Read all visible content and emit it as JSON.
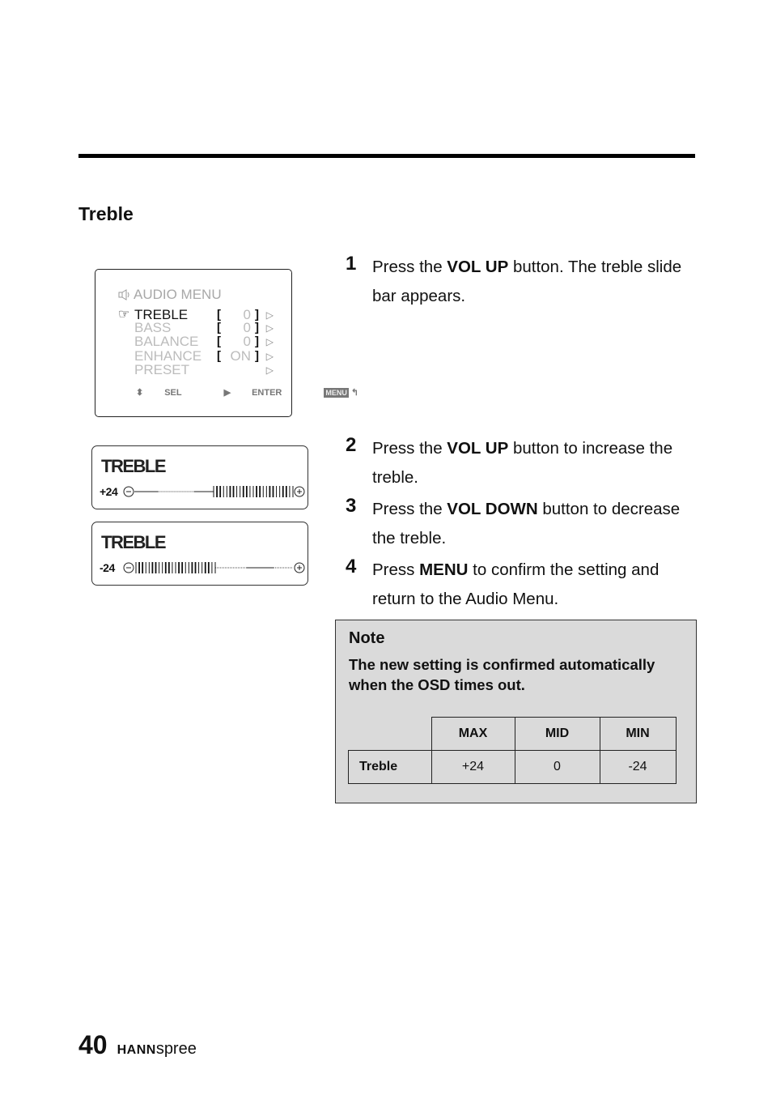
{
  "section_title": "Treble",
  "osd_menu": {
    "title": "AUDIO  MENU",
    "items": [
      {
        "label": "TREBLE",
        "value": "0",
        "selected": true,
        "has_brackets": true
      },
      {
        "label": "BASS",
        "value": "0",
        "selected": false,
        "has_brackets": true
      },
      {
        "label": "BALANCE",
        "value": "0",
        "selected": false,
        "has_brackets": true
      },
      {
        "label": "ENHANCE",
        "value": "ON",
        "selected": false,
        "has_brackets": true
      },
      {
        "label": "PRESET",
        "value": "",
        "selected": false,
        "has_brackets": false
      }
    ],
    "footer": {
      "sel": "SEL",
      "enter": "ENTER",
      "menu": "MENU"
    }
  },
  "sliders": [
    {
      "title": "TREBLE",
      "value_label": "+24",
      "fill_fraction": 1.0
    },
    {
      "title": "TREBLE",
      "value_label": "-24",
      "fill_fraction": 0.0
    }
  ],
  "steps": [
    {
      "num": "1",
      "pre": "Press the ",
      "bold": "VOL UP",
      "post": " button. The treble slide bar appears."
    },
    {
      "num": "2",
      "pre": "Press the ",
      "bold": "VOL UP",
      "post": " button to increase the treble."
    },
    {
      "num": "3",
      "pre": "Press the ",
      "bold": "VOL DOWN",
      "post": " button to decrease the treble."
    },
    {
      "num": "4",
      "pre": "Press ",
      "bold": "MENU",
      "post": " to confirm the setting and return to the Audio Menu."
    }
  ],
  "note": {
    "title": "Note",
    "text": "The new setting is confirmed automatically when the OSD times out.",
    "table": {
      "columns": [
        "MAX",
        "MID",
        "MIN"
      ],
      "rows": [
        {
          "label": "Treble",
          "values": [
            "+24",
            "0",
            "-24"
          ]
        }
      ]
    }
  },
  "footer": {
    "page_number": "40",
    "brand_bold": "HANN",
    "brand_light": "spree"
  }
}
